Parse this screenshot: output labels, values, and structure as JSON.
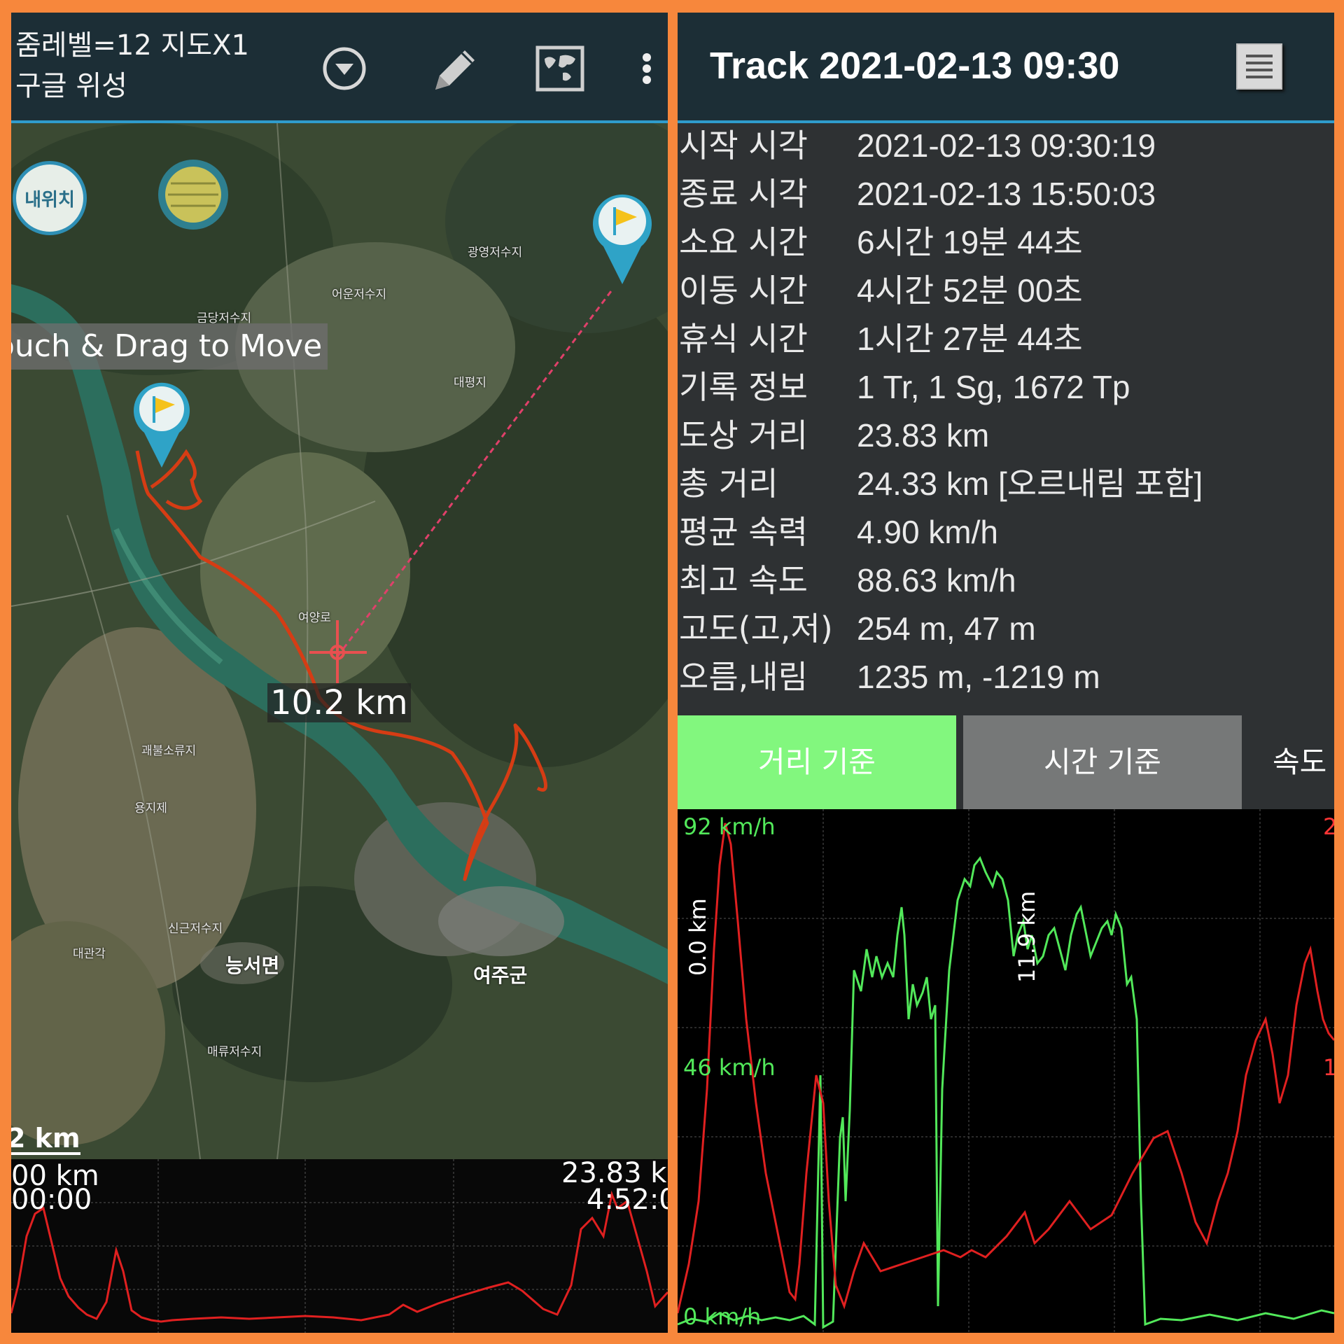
{
  "map_screen": {
    "zoom_status": "줌레벨=12 지도X1",
    "map_type": "구글 위성",
    "toolbar_icons": [
      "dropdown-circle-icon",
      "pencil-icon",
      "world-map-icon",
      "more-vert-icon"
    ],
    "my_location_button": "내위치",
    "drag_hint": "ouch & Drag to Move",
    "distance_label": "10.2 km",
    "scale_bar": "2 km",
    "place_labels": {
      "neungseo": "능서면",
      "yeoju": "여주군",
      "yeoyang": "여양로",
      "daepyeong": "대평지",
      "eoun": "어운저수지",
      "gwangyeong": "광영저수지",
      "geumdang": "금당저수지",
      "sinan": "신근저수지",
      "maeryu": "매류저수지",
      "daegwan": "대관각",
      "yonggye": "용지제",
      "gwaebul": "괘불소류지"
    },
    "mini_chart": {
      "start_distance": "00 km",
      "start_time": "00:00",
      "end_distance": "23.83 k",
      "end_time": "4:52:0"
    }
  },
  "track_screen": {
    "title": "Track 2021-02-13 09:30",
    "menu_icon": "list-menu-icon",
    "stats": [
      {
        "label": "시작 시각",
        "value": "2021-02-13 09:30:19"
      },
      {
        "label": "종료 시각",
        "value": "2021-02-13 15:50:03"
      },
      {
        "label": "소요 시간",
        "value": "6시간 19분 44초"
      },
      {
        "label": "이동 시간",
        "value": "4시간 52분 00초"
      },
      {
        "label": "휴식 시간",
        "value": "1시간 27분 44초"
      },
      {
        "label": "기록 정보",
        "value": "1 Tr, 1 Sg, 1672 Tp"
      },
      {
        "label": "도상 거리",
        "value": "23.83 km"
      },
      {
        "label": "총 거리",
        "value": "24.33 km [오르내림 포함]"
      },
      {
        "label": "평균 속력",
        "value": "4.90 km/h"
      },
      {
        "label": "최고 속도",
        "value": "88.63 km/h"
      },
      {
        "label": "고도(고,저)",
        "value": "254 m, 47 m"
      },
      {
        "label": "오름,내림",
        "value": "1235 m, -1219 m"
      }
    ],
    "tabs": {
      "distance": "거리 기준",
      "time": "시간 기준",
      "speed": "속도"
    },
    "chart": {
      "speed_max": "92 km/h",
      "speed_mid": "46 km/h",
      "speed_min": "0 km/h",
      "right_top": "2",
      "right_mid": "1",
      "marker_start": "0.0 km",
      "marker_mid": "11.9 km",
      "colors": {
        "speed": "#52e85a",
        "elevation": "#ff3535",
        "tab_active": "#82f77e",
        "accent": "#2f9ccc"
      }
    }
  }
}
